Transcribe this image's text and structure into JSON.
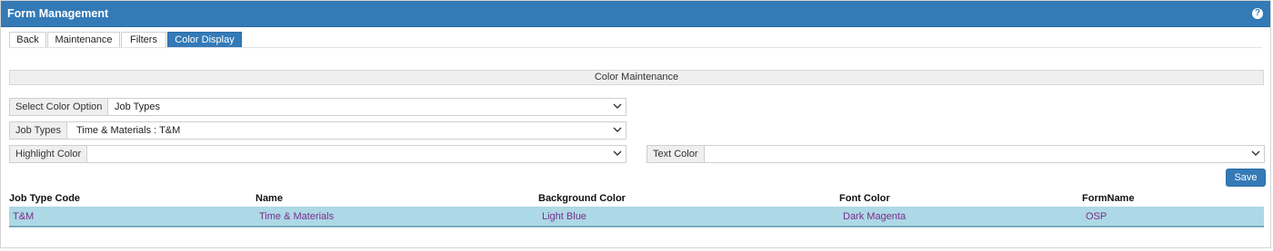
{
  "header": {
    "title": "Form Management",
    "help_icon": "?"
  },
  "tabs": [
    {
      "label": "Back",
      "active": false
    },
    {
      "label": "Maintenance",
      "active": false
    },
    {
      "label": "Filters",
      "active": false
    },
    {
      "label": "Color Display",
      "active": true
    }
  ],
  "section": {
    "title": "Color Maintenance"
  },
  "fields": {
    "color_option": {
      "label": "Select Color Option",
      "value": "Job Types"
    },
    "job_types": {
      "label": "Job Types",
      "value": "Time & Materials : T&M"
    },
    "highlight_color": {
      "label": "Highlight Color",
      "value": ""
    },
    "text_color": {
      "label": "Text Color",
      "value": ""
    }
  },
  "save_label": "Save",
  "table": {
    "columns": [
      "Job Type Code",
      "Name",
      "Background Color",
      "Font Color",
      "FormName"
    ],
    "rows": [
      [
        "T&M",
        "Time & Materials",
        "Light Blue",
        "Dark Magenta",
        "OSP"
      ]
    ]
  },
  "colors": {
    "accent": "#337ab7",
    "row_highlight": "#add8e6",
    "row_text": "#7a2d8a"
  }
}
